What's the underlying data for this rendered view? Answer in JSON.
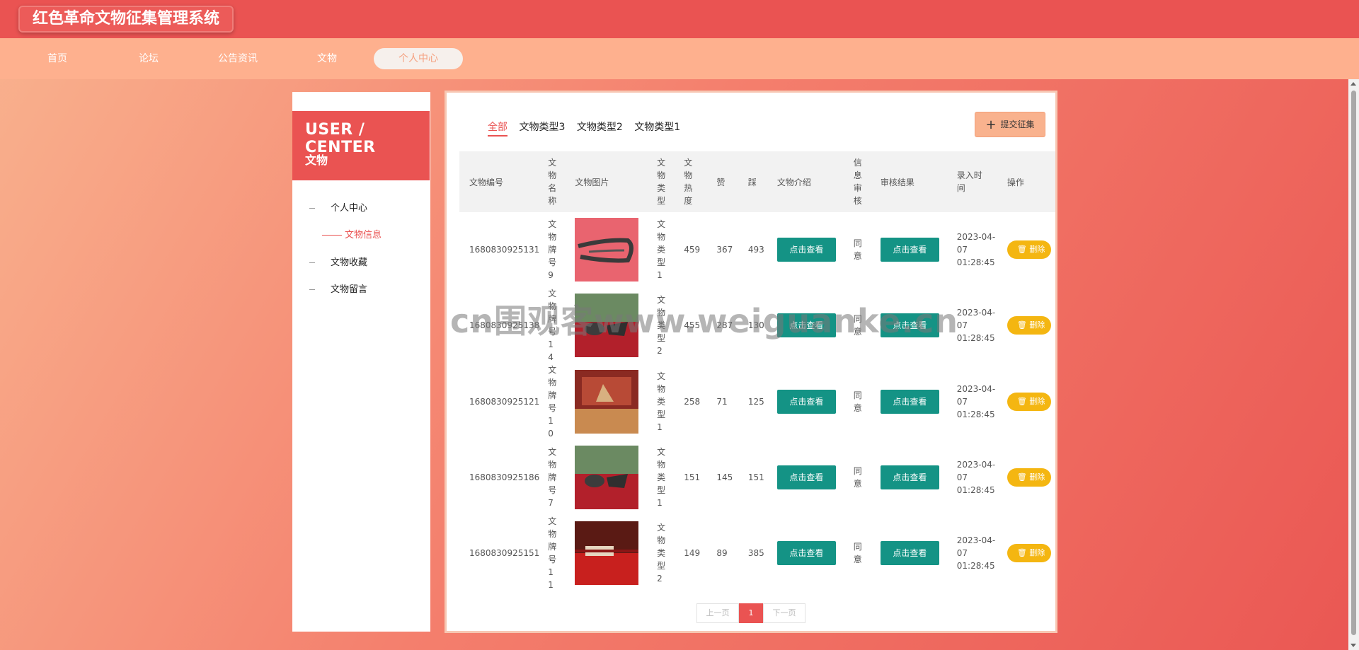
{
  "header": {
    "title": "红色革命文物征集管理系统"
  },
  "nav": {
    "items": [
      "首页",
      "论坛",
      "公告资讯",
      "文物",
      "个人中心"
    ],
    "active_index": 4
  },
  "sidebar": {
    "head_en": "USER / CENTER",
    "head_cn": "文物",
    "menu": [
      {
        "label": "个人中心"
      },
      {
        "label": "文物信息",
        "sub": true,
        "active": true
      },
      {
        "label": "文物收藏"
      },
      {
        "label": "文物留言"
      }
    ]
  },
  "filters": [
    "全部",
    "文物类型3",
    "文物类型2",
    "文物类型1"
  ],
  "submit_label": "提交征集",
  "table": {
    "headers": [
      "文物编号",
      "文物名称",
      "文物图片",
      "文物类型",
      "文物热度",
      "赞",
      "踩",
      "文物介绍",
      "信息审核",
      "审核结果",
      "录入时间",
      "操作"
    ],
    "rows": [
      {
        "no": "1680830925131",
        "name": "文物牌号9",
        "type": "文物类型1",
        "hot": "459",
        "up": "367",
        "down": "493",
        "intro": "点击查看",
        "audit": "同意",
        "result": "点击查看",
        "time": "2023-04-07 01:28:45",
        "op": "删除"
      },
      {
        "no": "1680830925138",
        "name": "文物牌号14",
        "type": "文物类型2",
        "hot": "455",
        "up": "287",
        "down": "130",
        "intro": "点击查看",
        "audit": "同意",
        "result": "点击查看",
        "time": "2023-04-07 01:28:45",
        "op": "删除"
      },
      {
        "no": "1680830925121",
        "name": "文物牌号10",
        "type": "文物类型1",
        "hot": "258",
        "up": "71",
        "down": "125",
        "intro": "点击查看",
        "audit": "同意",
        "result": "点击查看",
        "time": "2023-04-07 01:28:45",
        "op": "删除"
      },
      {
        "no": "1680830925186",
        "name": "文物牌号7",
        "type": "文物类型1",
        "hot": "151",
        "up": "145",
        "down": "151",
        "intro": "点击查看",
        "audit": "同意",
        "result": "点击查看",
        "time": "2023-04-07 01:28:45",
        "op": "删除"
      },
      {
        "no": "1680830925151",
        "name": "文物牌号11",
        "type": "文物类型2",
        "hot": "149",
        "up": "89",
        "down": "385",
        "intro": "点击查看",
        "audit": "同意",
        "result": "点击查看",
        "time": "2023-04-07 01:28:45",
        "op": "删除"
      }
    ]
  },
  "pager": {
    "prev": "上一页",
    "current": "1",
    "next": "下一页"
  },
  "watermark": "cn围观客www.weiguanke.cn",
  "colors": {
    "brand": "#ea5352",
    "nav_bg": "#feb08e",
    "action_green": "#149385",
    "delete_yellow": "#f4b611"
  }
}
